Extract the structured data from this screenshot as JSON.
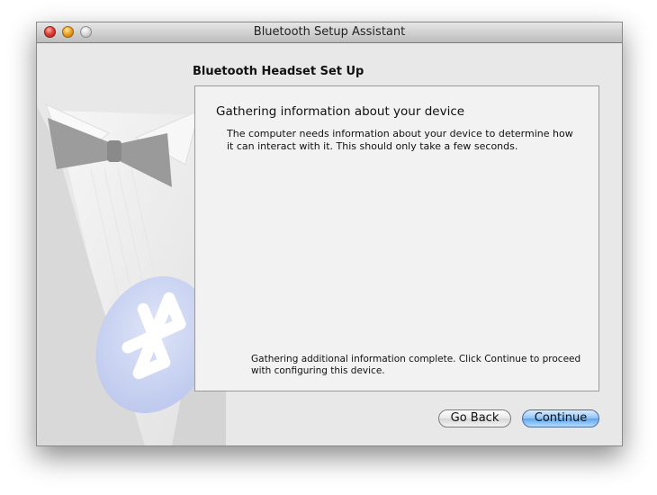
{
  "window": {
    "title": "Bluetooth Setup Assistant"
  },
  "page": {
    "heading": "Bluetooth Headset Set Up"
  },
  "panel": {
    "title": "Gathering information about your device",
    "description": "The computer needs information about your device to determine how it can interact with it. This should only take a few seconds.",
    "status": "Gathering additional information complete. Click Continue to proceed with configuring this device."
  },
  "buttons": {
    "back_label": "Go Back",
    "continue_label": "Continue"
  },
  "colors": {
    "accent": "#5ea5ef",
    "window_bg": "#e8e8e8",
    "bluetooth_badge": "#c9d3f2"
  },
  "icons": {
    "art": "tuxedo-bowtie-bluetooth-illustration"
  }
}
